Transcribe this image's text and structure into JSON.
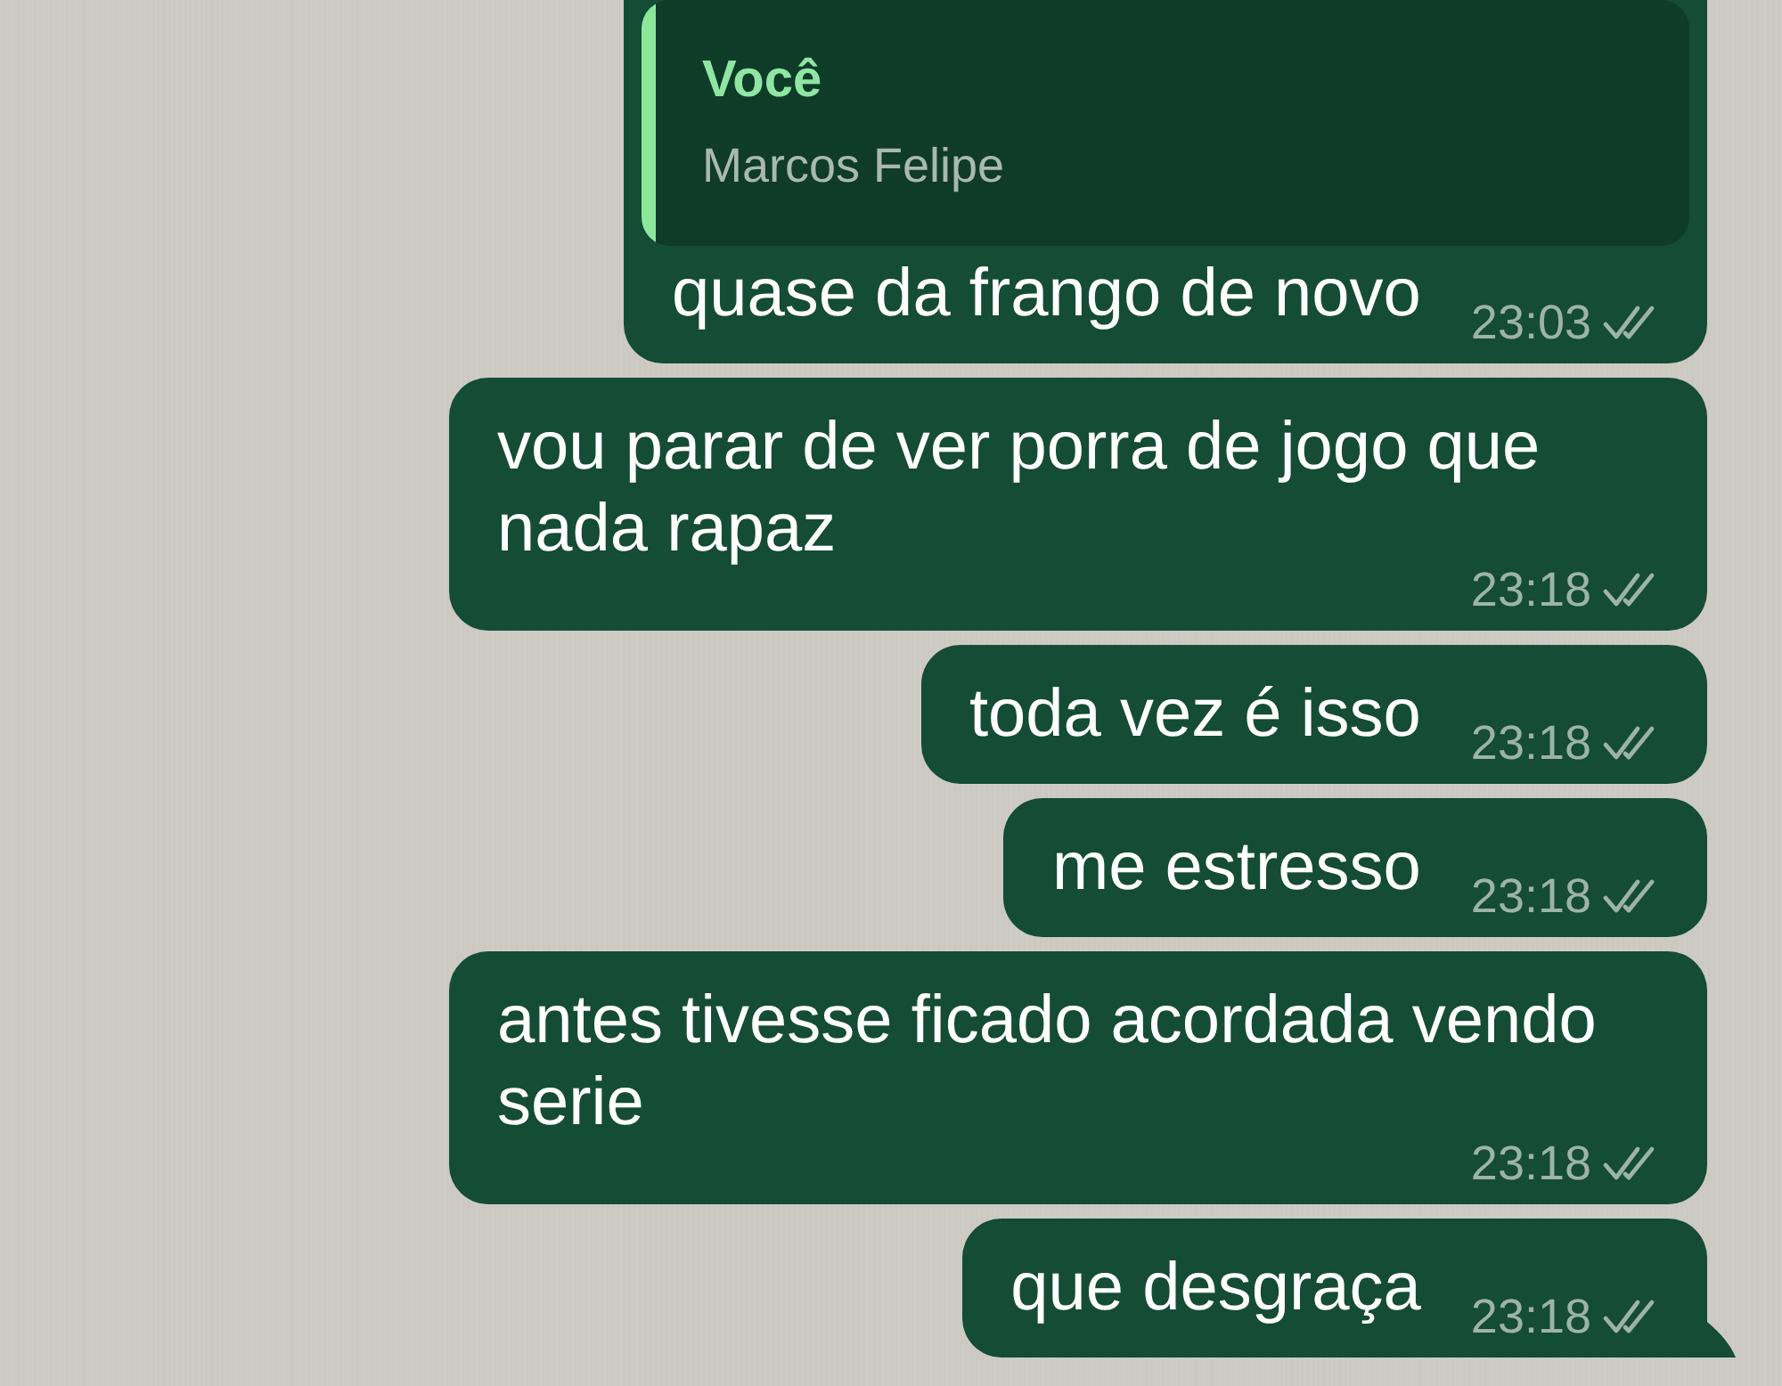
{
  "messages": [
    {
      "kind": "reply",
      "quote": {
        "author": "Você",
        "text": "Marcos Felipe"
      },
      "text": "quase da frango de novo",
      "time": "23:03",
      "read": false,
      "tail": false
    },
    {
      "kind": "text",
      "text": "vou parar de ver porra de jogo que nada rapaz",
      "time": "23:18",
      "read": false,
      "tail": false
    },
    {
      "kind": "text",
      "text": "toda vez é isso",
      "time": "23:18",
      "read": false,
      "tail": false
    },
    {
      "kind": "text",
      "text": "me estresso",
      "time": "23:18",
      "read": false,
      "tail": false
    },
    {
      "kind": "text",
      "text": "antes tivesse ficado acordada vendo serie",
      "time": "23:18",
      "read": false,
      "tail": false
    },
    {
      "kind": "text",
      "text": "que desgraça",
      "time": "23:18",
      "read": false,
      "tail": true
    }
  ]
}
